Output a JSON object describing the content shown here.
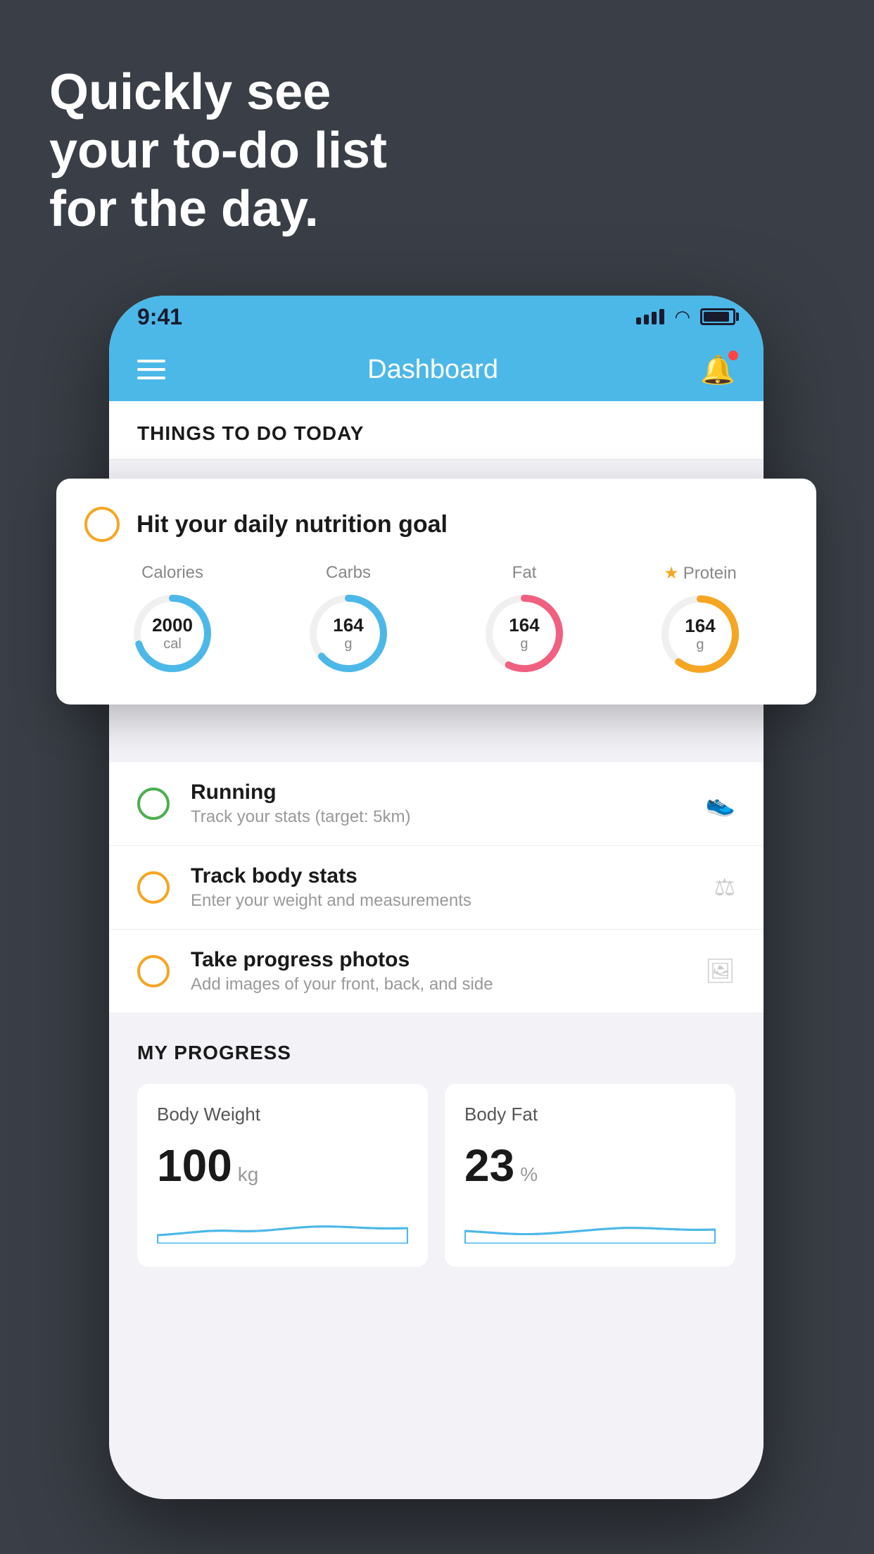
{
  "headline": {
    "line1": "Quickly see",
    "line2": "your to-do list",
    "line3": "for the day."
  },
  "status_bar": {
    "time": "9:41"
  },
  "header": {
    "title": "Dashboard"
  },
  "things_section": {
    "title": "THINGS TO DO TODAY"
  },
  "floating_card": {
    "title": "Hit your daily nutrition goal",
    "nutrition": [
      {
        "label": "Calories",
        "value": "2000",
        "unit": "cal",
        "starred": false,
        "color": "calories"
      },
      {
        "label": "Carbs",
        "value": "164",
        "unit": "g",
        "starred": false,
        "color": "carbs"
      },
      {
        "label": "Fat",
        "value": "164",
        "unit": "g",
        "starred": false,
        "color": "fat"
      },
      {
        "label": "Protein",
        "value": "164",
        "unit": "g",
        "starred": true,
        "color": "protein"
      }
    ]
  },
  "list_items": [
    {
      "title": "Running",
      "subtitle": "Track your stats (target: 5km)",
      "circle_color": "green",
      "icon": "shoe"
    },
    {
      "title": "Track body stats",
      "subtitle": "Enter your weight and measurements",
      "circle_color": "yellow",
      "icon": "scale"
    },
    {
      "title": "Take progress photos",
      "subtitle": "Add images of your front, back, and side",
      "circle_color": "yellow",
      "icon": "photo"
    }
  ],
  "progress_section": {
    "title": "MY PROGRESS",
    "cards": [
      {
        "title": "Body Weight",
        "value": "100",
        "unit": "kg"
      },
      {
        "title": "Body Fat",
        "value": "23",
        "unit": "%"
      }
    ]
  },
  "colors": {
    "accent_blue": "#4cb8e8",
    "accent_yellow": "#f5a623",
    "accent_green": "#4CAF50",
    "accent_red": "#f06080"
  }
}
